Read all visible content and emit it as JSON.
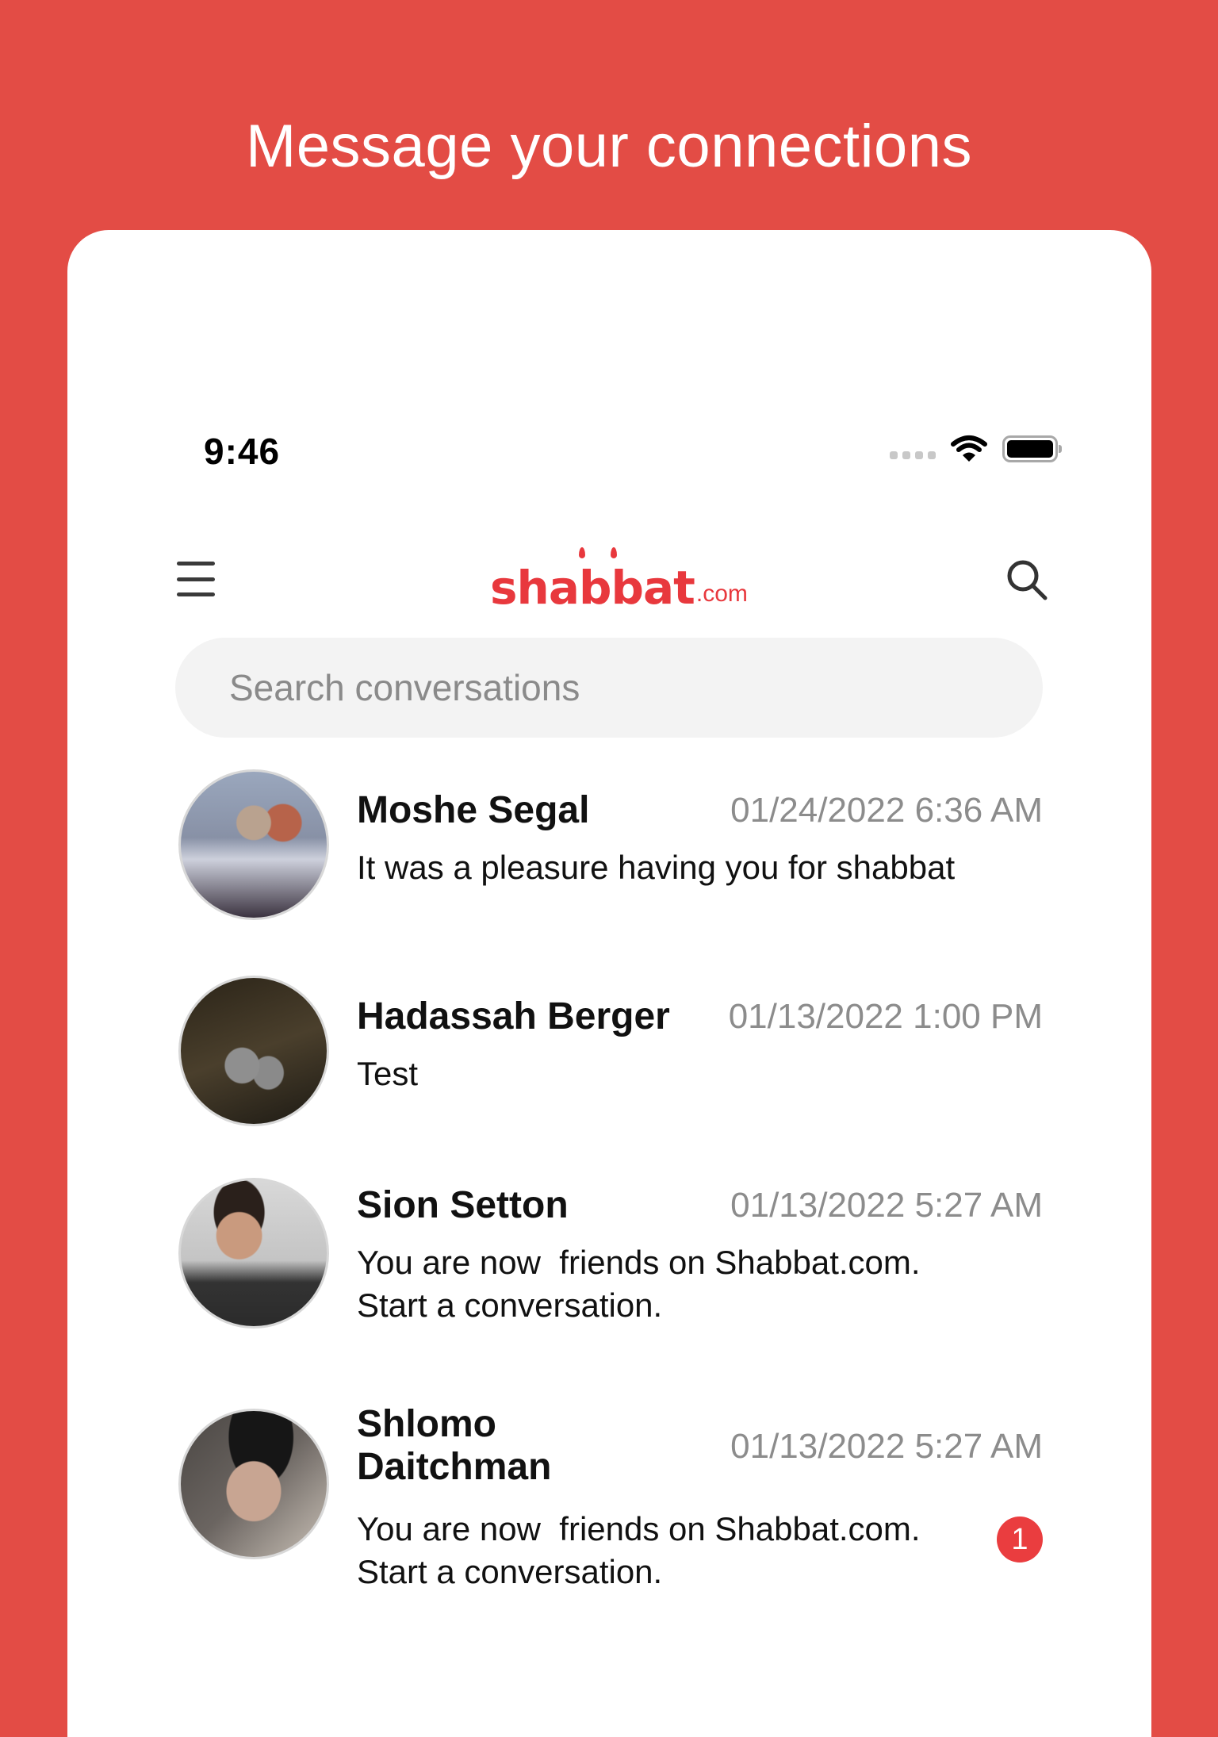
{
  "headline": "Message your connections",
  "status_bar": {
    "time": "9:46",
    "icons": [
      "signal-dots-icon",
      "wifi-icon",
      "battery-icon"
    ]
  },
  "nav": {
    "menu_icon": "hamburger-menu-icon",
    "logo_text": "shabbat",
    "logo_suffix": ".com",
    "search_icon": "search-icon"
  },
  "colors": {
    "background": "#e34c45",
    "brand": "#e8383d",
    "badge": "#ea3d3f",
    "timestamp": "#8c8c8c",
    "search_bg": "#f3f3f3"
  },
  "search": {
    "placeholder": "Search conversations",
    "value": ""
  },
  "conversations": [
    {
      "name": "Moshe Segal",
      "timestamp": "01/24/2022 6:36 AM",
      "preview": "It was a pleasure having you for shabbat",
      "unread": null
    },
    {
      "name": "Hadassah Berger",
      "timestamp": "01/13/2022 1:00 PM",
      "preview": "Test",
      "unread": null
    },
    {
      "name": "Sion Setton",
      "timestamp": "01/13/2022 5:27 AM",
      "preview": "You are now  friends on Shabbat.com.\nStart a conversation.",
      "unread": null
    },
    {
      "name": "Shlomo Daitchman",
      "timestamp": "01/13/2022 5:27 AM",
      "preview": "You are now  friends on Shabbat.com.\nStart a conversation.",
      "unread": "1"
    }
  ]
}
